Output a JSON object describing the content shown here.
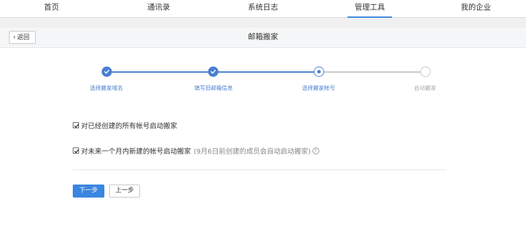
{
  "nav": {
    "items": [
      {
        "label": "首页"
      },
      {
        "label": "通讯录"
      },
      {
        "label": "系统日志"
      },
      {
        "label": "管理工具"
      },
      {
        "label": "我的企业"
      }
    ],
    "active_index": 3
  },
  "header": {
    "back_label": "返回",
    "title": "邮箱搬家"
  },
  "steps": [
    {
      "label": "选择搬家域名",
      "status": "done"
    },
    {
      "label": "填写旧邮箱信息",
      "status": "done"
    },
    {
      "label": "选择搬家帐号",
      "status": "current"
    },
    {
      "label": "启动搬家",
      "status": "todo"
    }
  ],
  "options": {
    "existing": {
      "label": "对已经创建的所有帐号启动搬家",
      "checked": true
    },
    "future": {
      "label": "对未来一个月内新建的帐号启动搬家",
      "hint": "(9月6日前创建的成员会自动启动搬家)",
      "checked": true
    }
  },
  "buttons": {
    "next_label": "下一步",
    "prev_label": "上一步"
  },
  "colors": {
    "accent": "#3a86e0",
    "step_active": "#4a7fd1",
    "step_inactive": "#c8c8c8"
  }
}
